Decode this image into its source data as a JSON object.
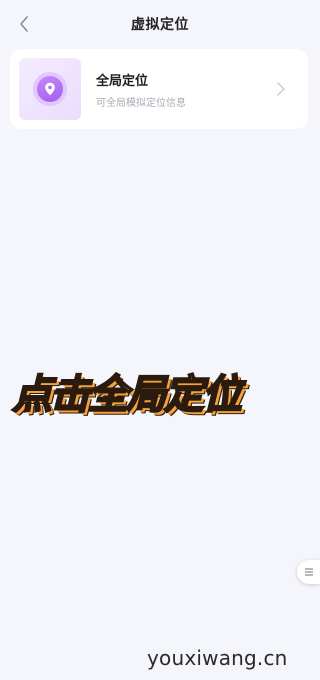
{
  "header": {
    "title": "虚拟定位",
    "back_icon": "chevron-left-icon"
  },
  "card": {
    "title": "全局定位",
    "subtitle": "可全局模拟定位信息",
    "icon": "location-pin-icon",
    "chevron_icon": "chevron-right-icon"
  },
  "overlay": {
    "caption": "点击全局定位"
  },
  "floating_handle": {
    "icon": "menu-lines-icon"
  },
  "watermark": {
    "text": "youxiwang.cn"
  },
  "colors": {
    "background": "#f5f6fb",
    "card_background": "#ffffff",
    "accent_purple": "#a55df0",
    "icon_tile": "#eadcfd",
    "caption_fill": "#fffaf0",
    "caption_outline": "#2b1a0e",
    "caption_shadow": "#f6a23a"
  }
}
